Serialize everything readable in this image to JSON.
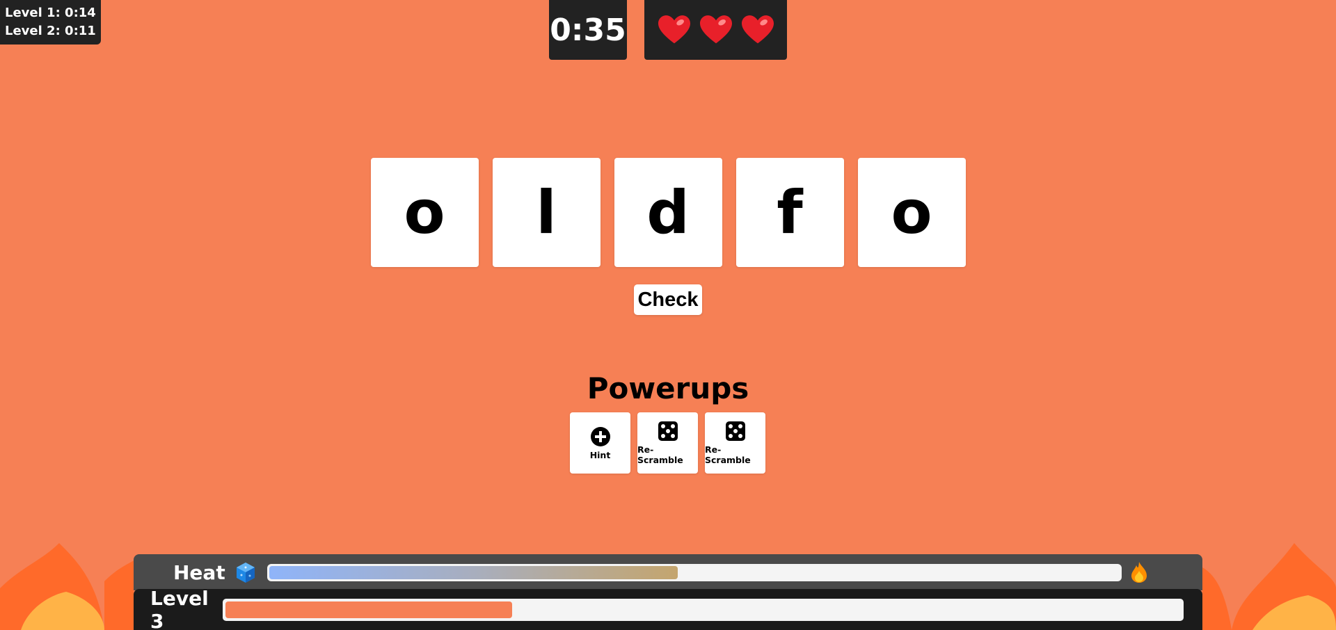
{
  "level_times": [
    "Level 1: 0:14",
    "Level 2: 0:11"
  ],
  "timer": "0:35",
  "lives": 3,
  "tiles": [
    "o",
    "l",
    "d",
    "f",
    "o"
  ],
  "check_label": "Check",
  "powerups": {
    "title": "Powerups",
    "items": [
      {
        "label": "Hint",
        "icon": "plus-circle-icon"
      },
      {
        "label": "Re-Scramble",
        "icon": "dice-icon"
      },
      {
        "label": "Re-Scramble",
        "icon": "dice-icon"
      }
    ]
  },
  "heat": {
    "label": "Heat",
    "progress": 0.48,
    "start_icon": "ice-cube-icon",
    "end_icon": "fire-icon"
  },
  "level": {
    "label": "Level 3",
    "progress": 0.3
  },
  "colors": {
    "background": "#f68055",
    "panel": "#222222",
    "heat_fill_start": "#8fb4f9",
    "heat_fill_end": "#c4a56e",
    "level_fill": "#f68055"
  }
}
